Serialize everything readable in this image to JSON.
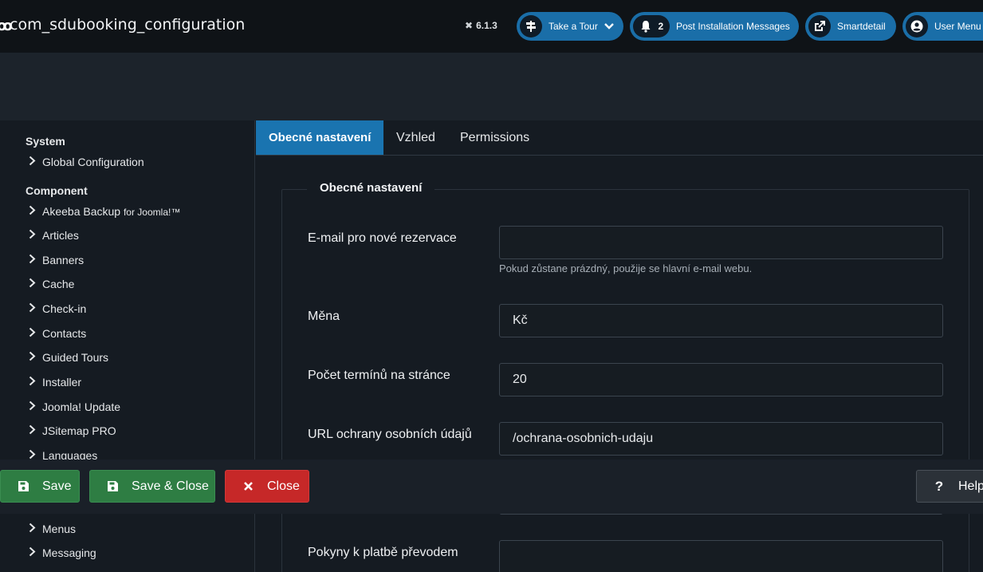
{
  "header": {
    "title": "com_sdubooking_configuration",
    "version": "6.1.3",
    "buttons": {
      "tour": "Take a Tour",
      "post_count": "2",
      "post": "Post Installation Messages",
      "smartdetail": "Smartdetail",
      "user": "User Menu"
    }
  },
  "sidebar": {
    "system_heading": "System",
    "global_config": "Global Configuration",
    "component_heading": "Component",
    "items": [
      "Akeeba Backup",
      "Articles",
      "Banners",
      "Cache",
      "Check-in",
      "Contacts",
      "Guided Tours",
      "Installer",
      "Joomla! Update",
      "JSitemap PRO",
      "Languages",
      "Menus",
      "Messaging"
    ],
    "akeeba_suffix": "for Joomla!™"
  },
  "tabs": [
    "Obecné nastavení",
    "Vzhled",
    "Permissions"
  ],
  "form": {
    "legend": "Obecné nastavení",
    "fields": [
      {
        "label": "E-mail pro nové rezervace",
        "value": "",
        "hint": "Pokud zůstane prázdný, použije se hlavní e-mail webu."
      },
      {
        "label": "Měna",
        "value": "Kč"
      },
      {
        "label": "Počet termínů na stránce",
        "value": "20"
      },
      {
        "label": "URL ochrany osobních údajů",
        "value": "/ochrana-osobnich-udaju"
      },
      {
        "label": "Pokyny k platbě převodem",
        "value": ""
      }
    ]
  },
  "toolbar": {
    "save": "Save",
    "save_close": "Save & Close",
    "close": "Close",
    "help": "Help"
  },
  "colors": {
    "primary": "#1a74b0",
    "success": "#2e7d43",
    "danger": "#c62828"
  }
}
